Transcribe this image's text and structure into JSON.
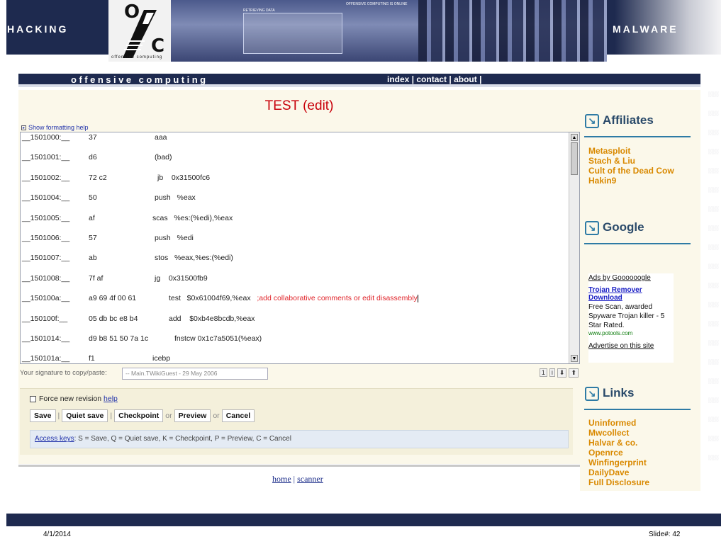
{
  "slide": {
    "left_label": "HACKING",
    "right_label": "MALWARE",
    "date": "4/1/2014",
    "slide_number": "Slide#: 42"
  },
  "banner": {
    "logo_top": "O",
    "logo_bottom": "C",
    "logo_tagline": "offensive computing",
    "screen_caption": "RETRIEVING DATA",
    "status_caption": "OFFENSIVE COMPUTING IS ONLINE"
  },
  "site": {
    "title": "offensive computing",
    "nav": [
      "index",
      "contact",
      "about"
    ]
  },
  "page": {
    "title": "TEST (edit)",
    "format_help": "Show formatting help",
    "lines": [
      {
        "addr": "__1501000:__",
        "bytes": "37",
        "instr": "aaa",
        "comment": ""
      },
      {
        "addr": "__1501001:__",
        "bytes": "d6",
        "instr": "(bad)",
        "comment": ""
      },
      {
        "addr": "__1501002:__",
        "bytes": "72 c2",
        "instr": "jb    0x31500fc6",
        "comment": ""
      },
      {
        "addr": "__1501004:__",
        "bytes": "50",
        "instr": "push   %eax",
        "comment": ""
      },
      {
        "addr": "__1501005:__",
        "bytes": "af",
        "instr": "scas   %es:(%edi),%eax",
        "comment": ""
      },
      {
        "addr": "__1501006:__",
        "bytes": "57",
        "instr": "push   %edi",
        "comment": ""
      },
      {
        "addr": "__1501007:__",
        "bytes": "ab",
        "instr": "stos   %eax,%es:(%edi)",
        "comment": ""
      },
      {
        "addr": "__1501008:__",
        "bytes": "7f af",
        "instr": "jg    0x31500fb9",
        "comment": ""
      },
      {
        "addr": "__150100a:__",
        "bytes": "a9 69 4f 00 61",
        "instr": "test   $0x61004f69,%eax",
        "comment": ";add collaborative comments or edit disassembly"
      },
      {
        "addr": "__150100f:__",
        "bytes": "05 db bc e8 b4",
        "instr": "add    $0xb4e8bcdb,%eax",
        "comment": ""
      },
      {
        "addr": "__1501014:__",
        "bytes": "d9 b8 51 50 7a 1c",
        "instr": "fnstcw 0x1c7a5051(%eax)",
        "comment": ""
      },
      {
        "addr": "__150101a:__",
        "bytes": "f1",
        "instr": "icebp",
        "comment": ""
      }
    ],
    "signature_label": "Your signature to copy/paste:",
    "signature_value": "-- Main.TWikiGuest - 29 May 2006",
    "toolbar_icons": [
      "1",
      "i",
      "⬇",
      "⬆"
    ],
    "force_revision": "Force new revision",
    "help_link": "help",
    "buttons": {
      "save": "Save",
      "quiet_save": "Quiet save",
      "checkpoint": "Checkpoint",
      "preview": "Preview",
      "cancel": "Cancel",
      "or": "or"
    },
    "access_keys_link": "Access keys",
    "access_keys_text": ": S = Save, Q = Quiet save, K = Checkpoint, P = Preview, C = Cancel",
    "footer_links": [
      "home",
      "scanner"
    ]
  },
  "sidebar": {
    "affiliates_title": "Affiliates",
    "affiliates": [
      "Metasploit",
      "Stach & Liu",
      "Cult of the Dead Cow",
      "Hakin9"
    ],
    "google_title": "Google",
    "ads": {
      "ads_by": "Ads by Goooooogle",
      "title": "Trojan Remover Download",
      "body": "Free Scan, awarded Spyware Trojan killer - 5 Star Rated.",
      "url": "www.potools.com",
      "advertise": "Advertise on this site"
    },
    "links_title": "Links",
    "links": [
      "Uninformed",
      "Mwcollect",
      "Halvar & co.",
      "Openrce",
      "Winfingerprint",
      "DailyDave",
      "Full Disclosure"
    ]
  },
  "colors": {
    "navy": "#1e2a4f",
    "title_red": "#c8000a",
    "comment_red": "#e0242a",
    "sidebar_orange": "#d98900",
    "sidebar_head": "#2a4a6a",
    "accent_blue": "#2e7ba5"
  },
  "icons": {
    "sidebar_heading": "arrow-down-right-icon",
    "format_help": "triangle-right-icon",
    "scroll_up": "arrow-up-icon",
    "scroll_down": "arrow-down-icon"
  }
}
